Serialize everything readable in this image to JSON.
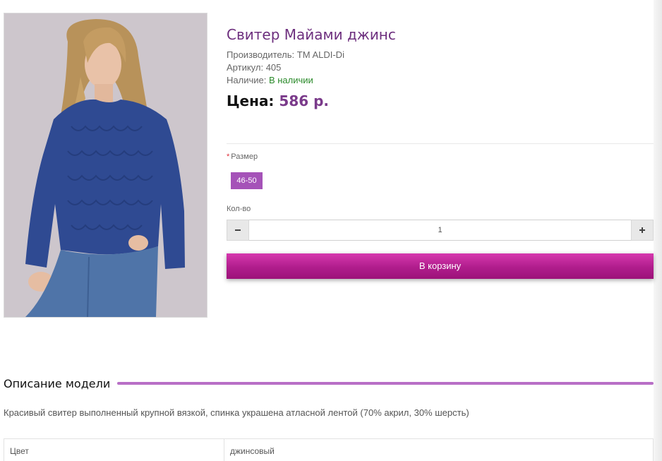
{
  "product": {
    "title": "Свитер Майами джинс",
    "manufacturer_label": "Производитель:",
    "manufacturer": "TM ALDI-Di",
    "sku_label": "Артикул:",
    "sku": "405",
    "availability_label": "Наличие:",
    "availability": "В наличии",
    "price_label": "Цена:",
    "price": "586 р.",
    "photo_icon": "sweater-model-photo"
  },
  "options": {
    "size_required_mark": "*",
    "size_label": "Размер",
    "size_selected": "46-50",
    "qty_label": "Кол-во",
    "qty_value": "1",
    "qty_minus_icon": "minus-icon",
    "qty_plus_icon": "plus-icon"
  },
  "actions": {
    "add_to_cart": "В корзину"
  },
  "description": {
    "heading": "Описание модели",
    "text": "Красивый свитер выполненный крупной вязкой, спинка украшена атласной лентой (70% акрил, 30% шерсть)",
    "attributes": [
      {
        "name": "Цвет",
        "value": "джинсовый"
      }
    ]
  },
  "colors": {
    "title": "#6d2f7e",
    "price": "#7a3a8a",
    "stock": "#2a8a2a",
    "chip": "#a552b8",
    "cart_button": "#b01d8c",
    "section_rule": "#b86fc6"
  }
}
